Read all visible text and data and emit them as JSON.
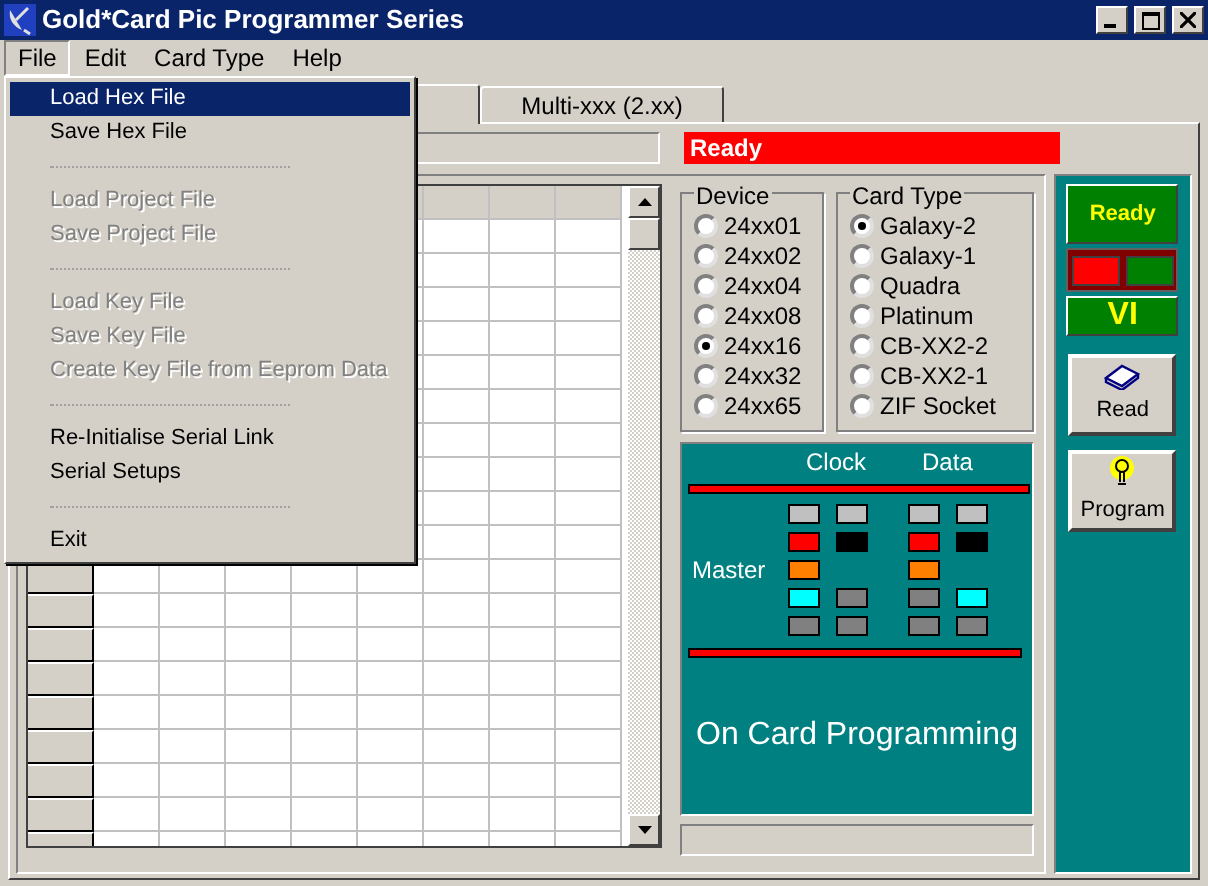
{
  "window": {
    "title": "Gold*Card Pic Programmer Series"
  },
  "menubar": [
    {
      "label": "File",
      "selected": true
    },
    {
      "label": "Edit",
      "selected": false
    },
    {
      "label": "Card Type",
      "selected": false
    },
    {
      "label": "Help",
      "selected": false
    }
  ],
  "file_menu": [
    {
      "kind": "item",
      "label": "Load Hex File",
      "disabled": false,
      "selected": true
    },
    {
      "kind": "item",
      "label": "Save Hex File",
      "disabled": false,
      "selected": false
    },
    {
      "kind": "separator"
    },
    {
      "kind": "item",
      "label": "Load Project File",
      "disabled": true,
      "selected": false
    },
    {
      "kind": "item",
      "label": "Save Project File",
      "disabled": true,
      "selected": false
    },
    {
      "kind": "separator"
    },
    {
      "kind": "item",
      "label": "Load Key File",
      "disabled": true,
      "selected": false
    },
    {
      "kind": "item",
      "label": "Save Key File",
      "disabled": true,
      "selected": false
    },
    {
      "kind": "item",
      "label": "Create Key File from Eeprom Data",
      "disabled": true,
      "selected": false
    },
    {
      "kind": "separator"
    },
    {
      "kind": "item",
      "label": "Re-Initialise Serial Link",
      "disabled": false,
      "selected": false
    },
    {
      "kind": "item",
      "label": "Serial Setups",
      "disabled": false,
      "selected": false
    },
    {
      "kind": "separator"
    },
    {
      "kind": "item",
      "label": "Exit",
      "disabled": false,
      "selected": false
    }
  ],
  "tabs": [
    {
      "selected": true
    },
    {
      "label": "Multi-xxx   (2.xx)",
      "selected": false
    }
  ],
  "status": "Ready",
  "device": {
    "title": "Device",
    "options": [
      {
        "label": "24xx01",
        "selected": false
      },
      {
        "label": "24xx02",
        "selected": false
      },
      {
        "label": "24xx04",
        "selected": false
      },
      {
        "label": "24xx08",
        "selected": false
      },
      {
        "label": "24xx16",
        "selected": true
      },
      {
        "label": "24xx32",
        "selected": false
      },
      {
        "label": "24xx65",
        "selected": false
      }
    ]
  },
  "card_type": {
    "title": "Card Type",
    "options": [
      {
        "label": "Galaxy-2",
        "selected": true
      },
      {
        "label": "Galaxy-1",
        "selected": false
      },
      {
        "label": "Quadra",
        "selected": false
      },
      {
        "label": "Platinum",
        "selected": false
      },
      {
        "label": "CB-XX2-2",
        "selected": false
      },
      {
        "label": "CB-XX2-1",
        "selected": false
      },
      {
        "label": "ZIF Socket",
        "selected": false
      }
    ]
  },
  "diagram": {
    "clock_label": "Clock",
    "data_label": "Data",
    "master_label": "Master",
    "caption": "On Card Programming",
    "rows": [
      {
        "cells": [
          {
            "color": "#c0c0c0"
          },
          {
            "color": "#c0c0c0"
          },
          {
            "color": "#c0c0c0"
          },
          {
            "color": "#c0c0c0"
          }
        ]
      },
      {
        "cells": [
          {
            "color": "#ff0000"
          },
          {
            "color": "#000000"
          },
          {
            "color": "#ff0000"
          },
          {
            "color": "#000000"
          }
        ]
      },
      {
        "cells": [
          {
            "color": "#ff8000"
          },
          {},
          {
            "color": "#ff8000"
          },
          {}
        ]
      },
      {
        "cells": [
          {
            "color": "#00ffff"
          },
          {
            "color": "#808080"
          },
          {
            "color": "#808080"
          },
          {
            "color": "#00ffff"
          }
        ]
      },
      {
        "cells": [
          {
            "color": "#808080"
          },
          {
            "color": "#808080"
          },
          {
            "color": "#808080"
          },
          {
            "color": "#808080"
          }
        ]
      }
    ]
  },
  "side_panel": {
    "status": "Ready",
    "lamps": [
      {
        "color": "#ff0000"
      },
      {
        "color": "#008000"
      }
    ],
    "version": "VI",
    "buttons": [
      {
        "kind": "read",
        "label": "Read"
      },
      {
        "kind": "program",
        "label": "Program"
      }
    ]
  }
}
